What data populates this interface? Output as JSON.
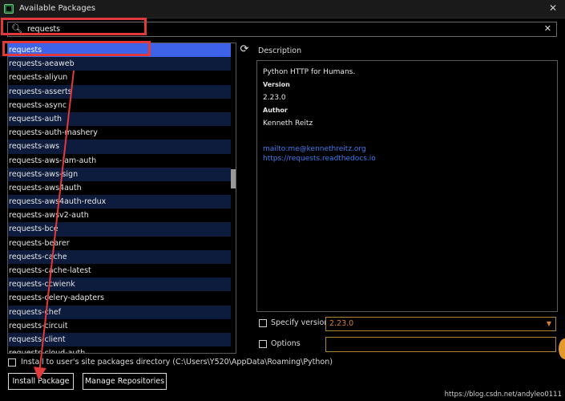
{
  "window": {
    "title": "Available Packages"
  },
  "search": {
    "value": "requests"
  },
  "packages": [
    "requests",
    "requests-aeaweb",
    "requests-aliyun",
    "requests-asserts",
    "requests-async",
    "requests-auth",
    "requests-auth-mashery",
    "requests-aws",
    "requests-aws-iam-auth",
    "requests-aws-sign",
    "requests-aws4auth",
    "requests-aws4auth-redux",
    "requests-awsv2-auth",
    "requests-bce",
    "requests-bearer",
    "requests-cache",
    "requests-cache-latest",
    "requests-ccwienk",
    "requests-celery-adapters",
    "requests-chef",
    "requests-circuit",
    "requests-client",
    "requests-cloud-auth"
  ],
  "selected_index": 0,
  "description": {
    "label": "Description",
    "summary": "Python HTTP for Humans.",
    "version_label": "Version",
    "version": "2.23.0",
    "author_label": "Author",
    "author": "Kenneth Reitz",
    "mailto": "mailto:me@kennethreitz.org",
    "url": "https://requests.readthedocs.io"
  },
  "specify_version": {
    "label": "Specify version",
    "value": "2.23.0",
    "checked": false
  },
  "options": {
    "label": "Options",
    "value": "",
    "checked": false
  },
  "user_site": {
    "label": "Install to user's site packages directory (C:\\Users\\Y520\\AppData\\Roaming\\Python)",
    "checked": false
  },
  "buttons": {
    "install": "Install Package",
    "manage": "Manage Repositories"
  },
  "watermark": "https://blog.csdn.net/andyleo0111",
  "icons": {
    "app": "pycharm-icon",
    "search": "search-icon",
    "clear": "close-icon",
    "refresh": "refresh-icon",
    "dropdown": "chevron-down-icon"
  },
  "colors": {
    "selection": "#3f63e8",
    "alt_row": "#0d1b3c",
    "link": "#3f7cf0",
    "accent_orange": "#d47f2a",
    "annotation_red": "#e23a3a"
  }
}
